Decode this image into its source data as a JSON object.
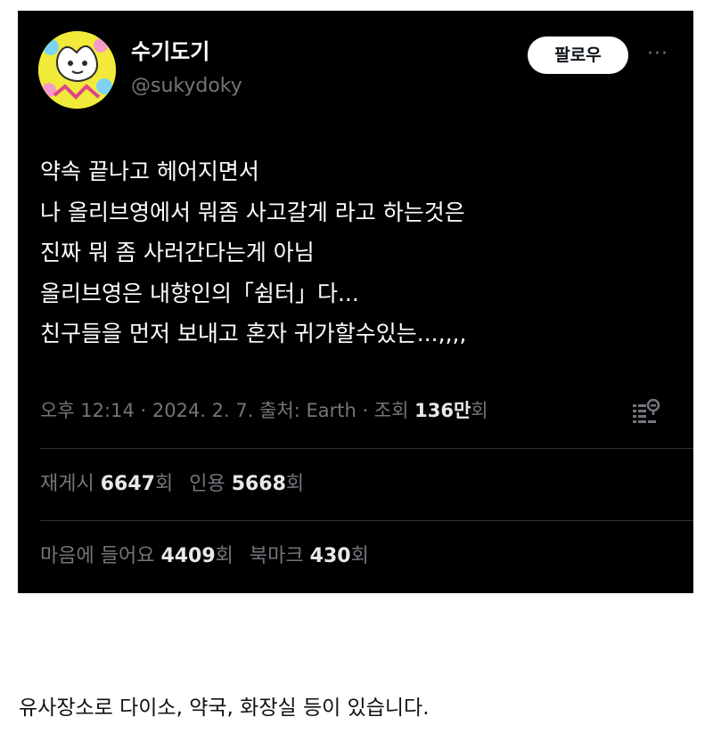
{
  "tweet": {
    "display_name": "수기도기",
    "handle": "@sukydoky",
    "follow_label": "팔로우",
    "more_glyph": "···",
    "text_lines": [
      "약속 끝나고 헤어지면서",
      "나 올리브영에서 뭐좀 사고갈게 라고 하는것은",
      "진짜 뭐 좀 사러간다는게 아님",
      "올리브영은 내향인의「쉼터」다...",
      "친구들을 먼저 보내고 혼자 귀가할수있는...,,,,"
    ],
    "meta": {
      "time_date_source": "오후 12:14 · 2024. 2. 7. 출처: Earth · 조회 ",
      "views_count": "136만",
      "views_unit": "회"
    },
    "stats": {
      "retweets_label": "재게시 ",
      "retweets_count": "6647",
      "retweets_unit": "회",
      "quotes_label": "인용 ",
      "quotes_count": "5668",
      "quotes_unit": "회",
      "likes_label": "마음에 들어요 ",
      "likes_count": "4409",
      "likes_unit": "회",
      "bookmarks_label": "북마크 ",
      "bookmarks_count": "430",
      "bookmarks_unit": "회"
    }
  },
  "caption": "유사장소로 다이소, 약국, 화장실 등이 있습니다.",
  "colors": {
    "card_background": "#000000",
    "primary_text": "#e7e9ea",
    "secondary_text": "#71767b",
    "divider": "#2f3336",
    "follow_button_bg": "#ffffff",
    "avatar_yellow": "#f1ea3a"
  },
  "icons": {
    "more": "more-icon",
    "analytics": "analytics-icon",
    "avatar": "avatar"
  }
}
